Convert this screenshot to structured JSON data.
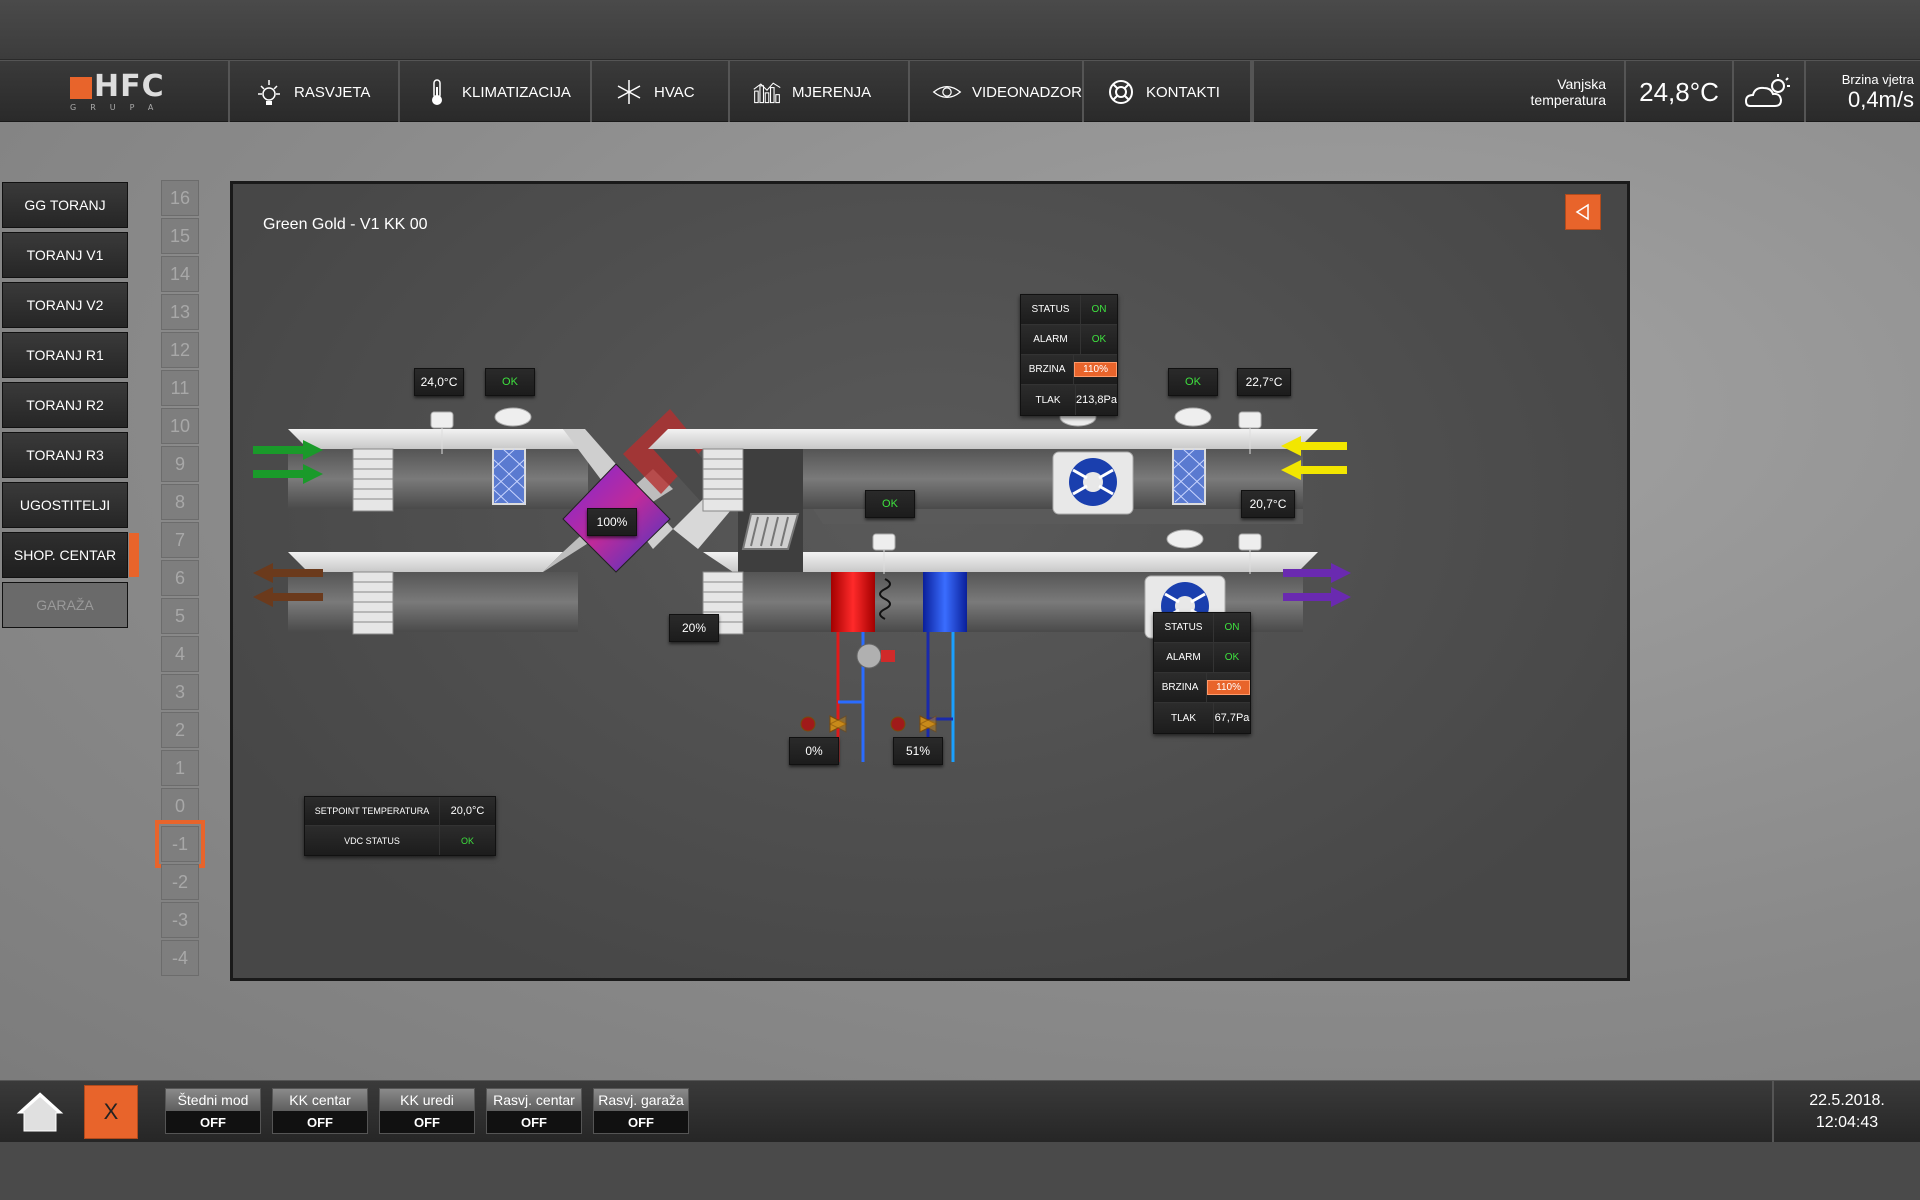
{
  "logo": {
    "brand": "HFC",
    "sub": "GRUPA"
  },
  "nav": [
    {
      "label": "RASVJETA",
      "icon": "sun-icon"
    },
    {
      "label": "KLIMATIZACIJA",
      "icon": "thermometer-icon",
      "active": true
    },
    {
      "label": "HVAC",
      "icon": "snowflake-sun-icon"
    },
    {
      "label": "MJERENJA",
      "icon": "bar-chart-icon"
    },
    {
      "label": "VIDEONADZOR",
      "icon": "eye-icon"
    },
    {
      "label": "KONTAKTI",
      "icon": "lifebuoy-icon"
    }
  ],
  "weather": {
    "outside_label_1": "Vanjska",
    "outside_label_2": "temperatura",
    "outside_temp": "24,8°C",
    "icon": "cloudy-sun-icon",
    "wind_label": "Brzina vjetra",
    "wind_value": "0,4m/s"
  },
  "accent_color": "#e8642b",
  "sidebar": [
    {
      "label": "GG TORANJ"
    },
    {
      "label": "TORANJ V1"
    },
    {
      "label": "TORANJ V2"
    },
    {
      "label": "TORANJ R1"
    },
    {
      "label": "TORANJ R2"
    },
    {
      "label": "TORANJ R3"
    },
    {
      "label": "UGOSTITELJI"
    },
    {
      "label": "SHOP. CENTAR",
      "active": true
    },
    {
      "label": "GARAŽA",
      "disabled": true
    }
  ],
  "floors": [
    "16",
    "15",
    "14",
    "13",
    "12",
    "11",
    "10",
    "9",
    "8",
    "7",
    "6",
    "5",
    "4",
    "3",
    "2",
    "1",
    "0",
    "-1",
    "-2",
    "-3",
    "-4"
  ],
  "selected_floor": "-1",
  "panel": {
    "title": "Green Gold - V1 KK 00",
    "values": {
      "temp_supply_left": "24,0°C",
      "ok_filter_left": "OK",
      "ok_filter_right": "OK",
      "temp_outside_right": "22,7°C",
      "ok_mid": "OK",
      "temp_mid_right": "20,7°C",
      "recuperator": "100%",
      "damper_mix": "20%",
      "valve_heat": "0%",
      "valve_cool": "51%"
    },
    "fan_top": {
      "status_label": "STATUS",
      "status": "ON",
      "alarm_label": "ALARM",
      "alarm": "OK",
      "speed_label": "BRZINA",
      "speed": "110%",
      "pressure_label": "TLAK",
      "pressure": "213,8Pa"
    },
    "fan_bottom": {
      "status_label": "STATUS",
      "status": "ON",
      "alarm_label": "ALARM",
      "alarm": "OK",
      "speed_label": "BRZINA",
      "speed": "110%",
      "pressure_label": "TLAK",
      "pressure": "67,7Pa"
    },
    "setpoint": {
      "label": "SETPOINT TEMPERATURA",
      "value": "20,0°C",
      "vdc_label": "VDC STATUS",
      "vdc_value": "OK"
    }
  },
  "bottom": {
    "home_icon": "home-icon",
    "x_label": "X",
    "modes": [
      {
        "title": "Štedni mod",
        "state": "OFF"
      },
      {
        "title": "KK centar",
        "state": "OFF"
      },
      {
        "title": "KK uredi",
        "state": "OFF"
      },
      {
        "title": "Rasvj. centar",
        "state": "OFF"
      },
      {
        "title": "Rasvj. garaža",
        "state": "OFF"
      }
    ],
    "date": "22.5.2018.",
    "time": "12:04:43"
  }
}
